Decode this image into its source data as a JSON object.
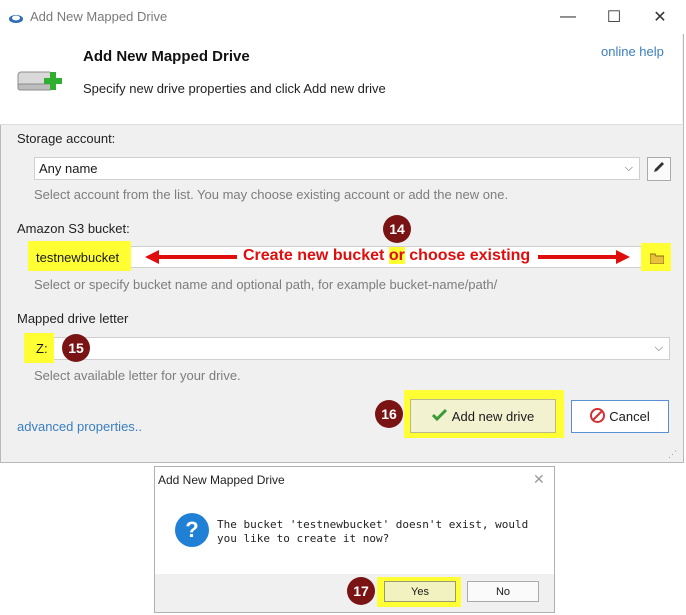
{
  "window": {
    "title": "Add New Mapped Drive",
    "controls": {
      "minimize": "—",
      "maximize": "☐",
      "close": "✕"
    }
  },
  "header": {
    "title": "Add New Mapped Drive",
    "subtitle": "Specify new drive properties and click Add new drive",
    "help_link": "online help"
  },
  "storage": {
    "label": "Storage account:",
    "value": "Any name",
    "hint": "Select account from the list. You may choose existing account or add the new one."
  },
  "bucket": {
    "label": "Amazon S3 bucket:",
    "value": "testnewbucket",
    "hint": "Select or specify bucket name and optional path, for example bucket-name/path/"
  },
  "annotation": {
    "text_before": "Create new bucket ",
    "text_or": "or",
    "text_after": " choose existing",
    "color": "#e00d0d"
  },
  "drive_letter": {
    "label": "Mapped drive letter",
    "value": "Z:",
    "hint": "Select available letter for your drive."
  },
  "markers": [
    "14",
    "15",
    "16",
    "17"
  ],
  "buttons": {
    "add": "Add new drive",
    "cancel": "Cancel"
  },
  "advanced_link": "advanced properties..",
  "dialog": {
    "title": "Add New Mapped Drive",
    "message": "The bucket 'testnewbucket' doesn't exist, would you like to create it now?",
    "yes": "Yes",
    "no": "No"
  },
  "colors": {
    "highlight": "#ffff33",
    "marker": "#7a1414",
    "link": "#3a7fc1"
  }
}
